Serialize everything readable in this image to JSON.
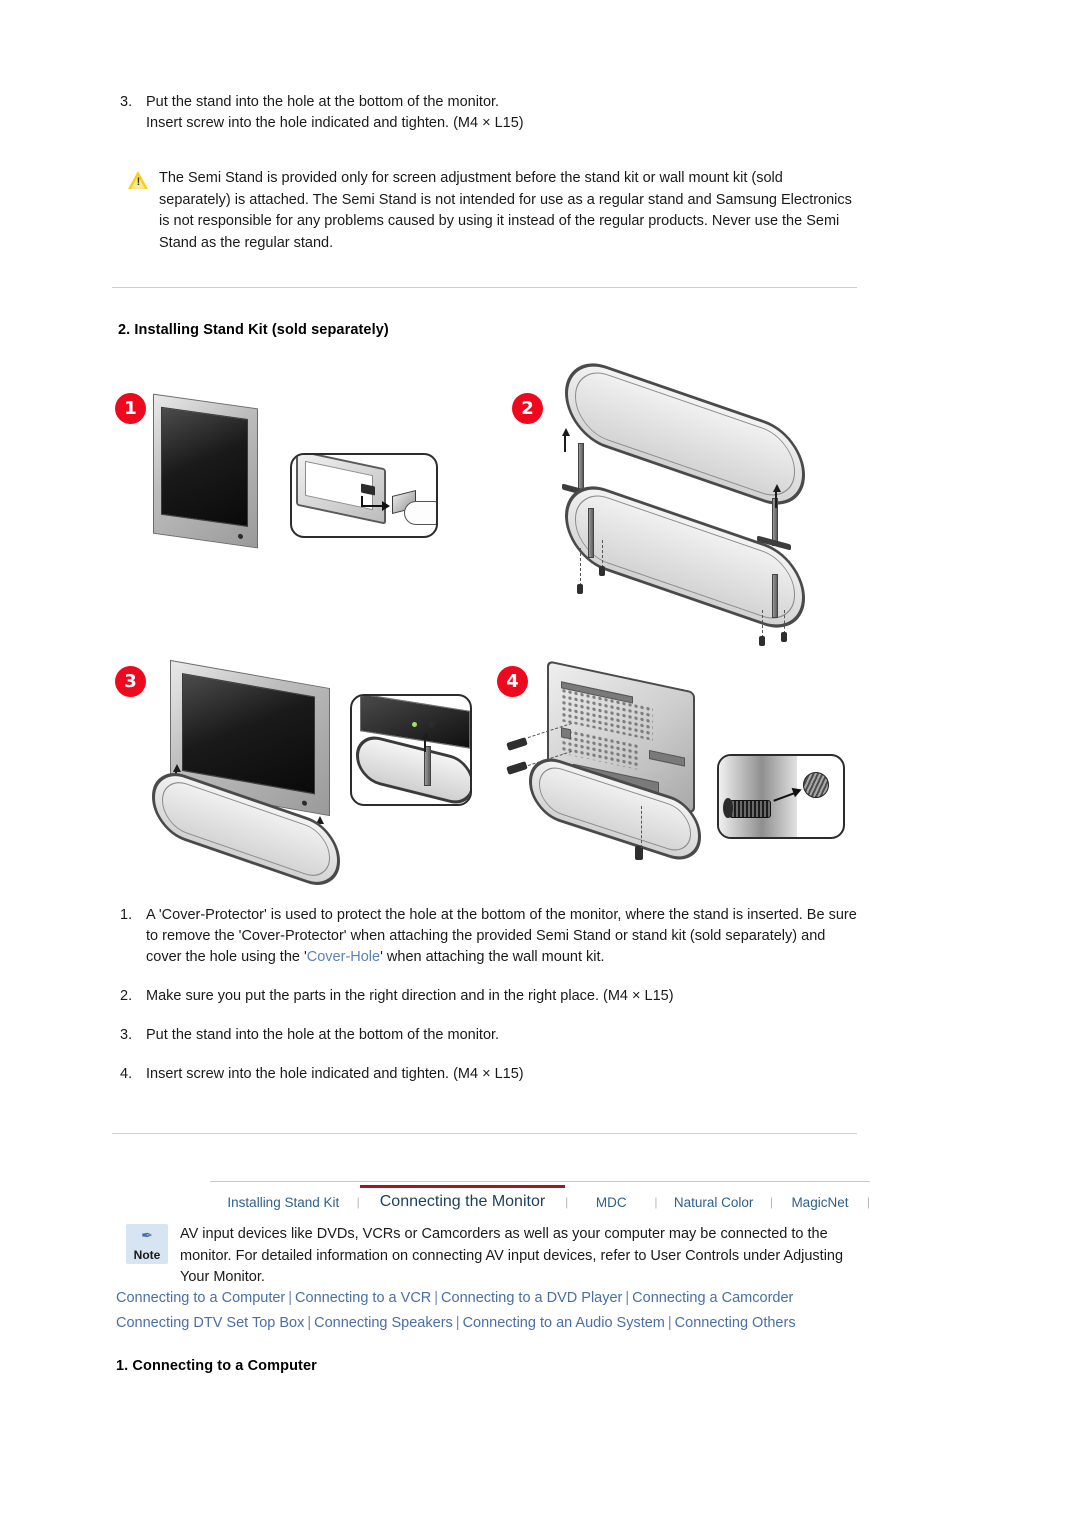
{
  "top_instruction": {
    "number": "3.",
    "line1": "Put the stand into the hole at the bottom of the monitor.",
    "line2": "Insert screw into the hole indicated and tighten. (M4 × L15)"
  },
  "warning": {
    "icon": "warning-triangle-icon",
    "text": "The Semi Stand is provided only for screen adjustment before the stand kit or wall mount kit (sold separately) is attached. The Semi Stand is not intended for use as a regular stand and Samsung Electronics is not responsible for any problems caused by using it instead of the regular products. Never use the Semi Stand as the regular stand."
  },
  "section_heading": "2. Installing Stand Kit (sold separately)",
  "figures": [
    {
      "badge": "1",
      "name": "monitor-front-with-cover-protector-inset"
    },
    {
      "badge": "2",
      "name": "stand-base-loop-with-posts"
    },
    {
      "badge": "3",
      "name": "monitor-inserted-into-stand-posts"
    },
    {
      "badge": "4",
      "name": "monitor-rear-screw-fastening"
    }
  ],
  "steps": [
    {
      "number": "1.",
      "text_before": "A 'Cover-Protector' is used to protect the hole at the bottom of the monitor, where the stand is inserted. Be sure to remove the 'Cover-Protector' when attaching the provided Semi Stand or stand kit (sold separately) and cover the hole using the '",
      "link": "Cover-Hole",
      "text_after": "' when attaching the wall mount kit."
    },
    {
      "number": "2.",
      "text_before": "Make sure you put the parts in the right direction and in the right place. (M4 × L15)",
      "link": "",
      "text_after": ""
    },
    {
      "number": "3.",
      "text_before": "Put the stand into the hole at the bottom of the monitor.",
      "link": "",
      "text_after": ""
    },
    {
      "number": "4.",
      "text_before": "Insert screw into the hole indicated and tighten. (M4 × L15)",
      "link": "",
      "text_after": ""
    }
  ],
  "tabs": [
    {
      "label": "Installing Stand Kit",
      "active": false
    },
    {
      "label": "Connecting the Monitor",
      "active": true
    },
    {
      "label": "MDC",
      "active": false
    },
    {
      "label": "Natural Color",
      "active": false
    },
    {
      "label": "MagicNet",
      "active": false
    }
  ],
  "tab_separator": "|",
  "note": {
    "icon": "pushpin-icon",
    "pin_glyph": "✒",
    "label": "Note",
    "text": "AV input devices like DVDs, VCRs or Camcorders as well as your computer may be connected to the monitor. For detailed information on connecting AV input devices, refer to User Controls under Adjusting Your Monitor."
  },
  "link_rows": [
    [
      "Connecting to a Computer",
      "Connecting to a VCR",
      "Connecting to a DVD Player",
      "Connecting a Camcorder"
    ],
    [
      "Connecting DTV Set Top Box",
      "Connecting Speakers",
      "Connecting to an Audio System",
      "Connecting Others"
    ]
  ],
  "link_separator": "|",
  "bottom_heading": "1. Connecting to a Computer",
  "colors": {
    "badge_red": "#ed0a1e",
    "active_tab_underline": "#9c1b22",
    "tab_blue": "#2f6088",
    "link_blue": "#4a6fa5",
    "note_bg": "#d7e4f2",
    "rule": "#cfcfcf"
  }
}
